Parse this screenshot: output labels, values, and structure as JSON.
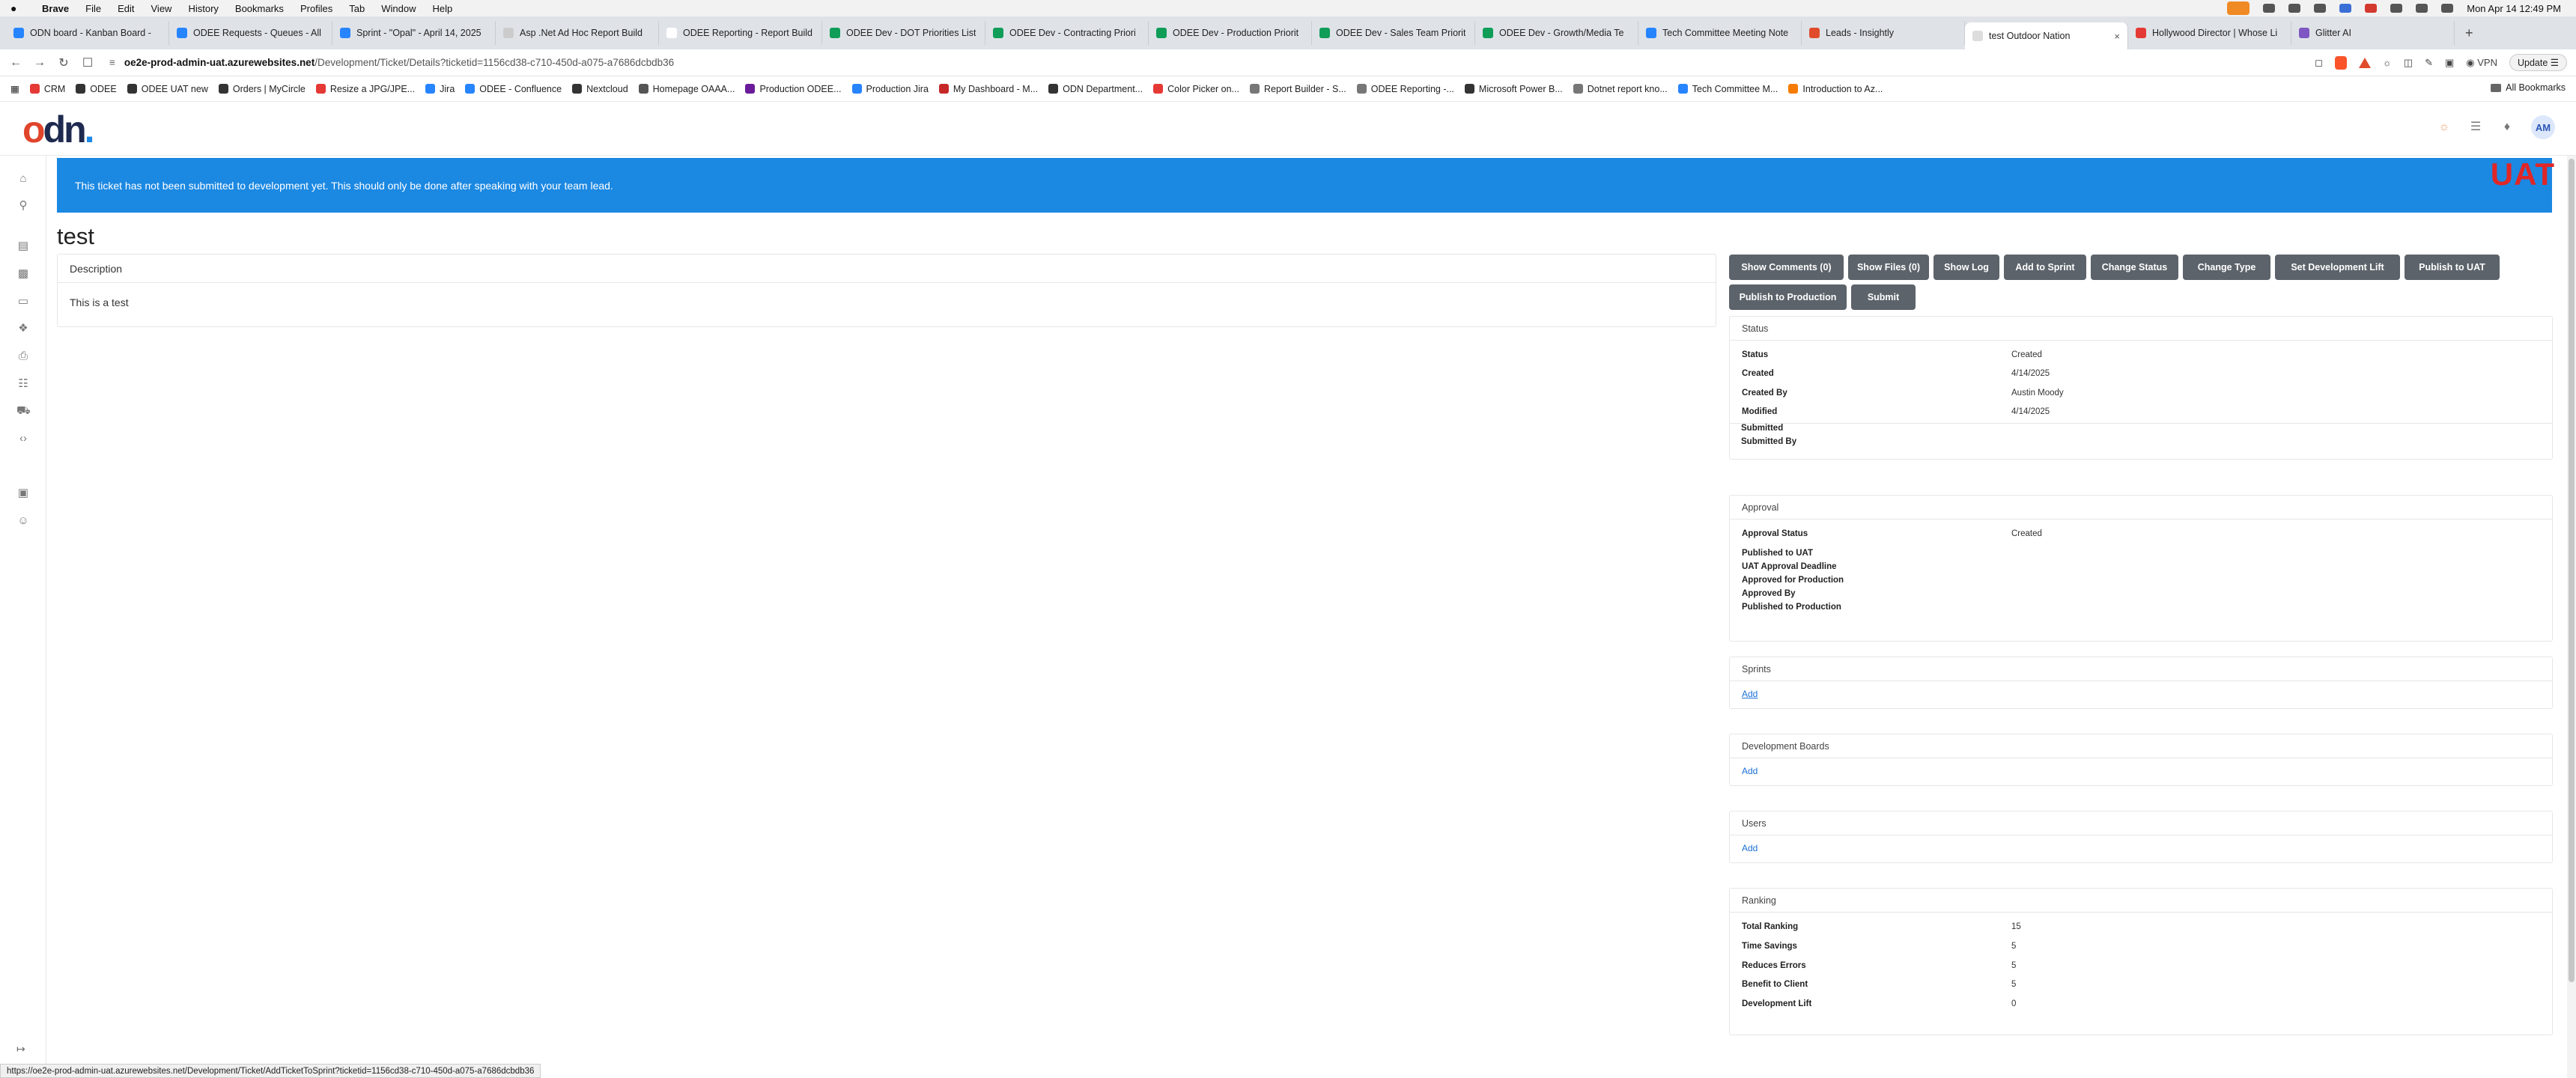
{
  "menubar": {
    "app": "Brave",
    "items": [
      "File",
      "Edit",
      "View",
      "History",
      "Bookmarks",
      "Profiles",
      "Tab",
      "Window",
      "Help"
    ],
    "datetime": "Mon Apr 14  12:49 PM"
  },
  "tabs": [
    {
      "label": "ODN board - Kanban Board -",
      "color": "#2684ff"
    },
    {
      "label": "ODEE Requests - Queues - All",
      "color": "#2684ff"
    },
    {
      "label": "Sprint - \"Opal\" - April 14, 2025",
      "color": "#2684ff"
    },
    {
      "label": "Asp .Net Ad Hoc Report Build",
      "color": "#cccccc"
    },
    {
      "label": "ODEE Reporting - Report Build",
      "color": "#ffffff"
    },
    {
      "label": "ODEE Dev - DOT Priorities List",
      "color": "#0f9d58"
    },
    {
      "label": "ODEE Dev - Contracting Priori",
      "color": "#0f9d58"
    },
    {
      "label": "ODEE Dev - Production Priorit",
      "color": "#0f9d58"
    },
    {
      "label": "ODEE Dev - Sales Team Priorit",
      "color": "#0f9d58"
    },
    {
      "label": "ODEE Dev - Growth/Media Te",
      "color": "#0f9d58"
    },
    {
      "label": "Tech Committee Meeting Note",
      "color": "#2684ff"
    },
    {
      "label": "Leads - Insightly",
      "color": "#e04b2c"
    },
    {
      "label": "test Outdoor Nation",
      "color": "#dddddd",
      "active": true
    },
    {
      "label": "Hollywood Director | Whose Li",
      "color": "#e53935"
    },
    {
      "label": "Glitter AI",
      "color": "#7e57c2"
    }
  ],
  "address": {
    "host": "oe2e-prod-admin-uat.azurewebsites.net",
    "path": "/Development/Ticket/Details?ticketid=1156cd38-c710-450d-a075-a7686dcbdb36",
    "vpn": "VPN",
    "update": "Update"
  },
  "bookmarks": [
    {
      "label": "CRM",
      "color": "#e53935"
    },
    {
      "label": "ODEE",
      "color": "#333333"
    },
    {
      "label": "ODEE UAT new",
      "color": "#333333"
    },
    {
      "label": "Orders | MyCircle",
      "color": "#333333"
    },
    {
      "label": "Resize a JPG/JPE...",
      "color": "#e53935"
    },
    {
      "label": "Jira",
      "color": "#2684ff"
    },
    {
      "label": "ODEE - Confluence",
      "color": "#2684ff"
    },
    {
      "label": "Nextcloud",
      "color": "#333333"
    },
    {
      "label": "Homepage OAAA...",
      "color": "#555555"
    },
    {
      "label": "Production ODEE...",
      "color": "#6a1b9a"
    },
    {
      "label": "Production Jira",
      "color": "#2684ff"
    },
    {
      "label": "My Dashboard - M...",
      "color": "#c62828"
    },
    {
      "label": "ODN Department...",
      "color": "#333333"
    },
    {
      "label": "Color Picker on...",
      "color": "#e53935"
    },
    {
      "label": "Report Builder - S...",
      "color": "#777777"
    },
    {
      "label": "ODEE Reporting -...",
      "color": "#777777"
    },
    {
      "label": "Microsoft Power B...",
      "color": "#333333"
    },
    {
      "label": "Dotnet report kno...",
      "color": "#777777"
    },
    {
      "label": "Tech Committee M...",
      "color": "#2684ff"
    },
    {
      "label": "Introduction to Az...",
      "color": "#f57c00"
    }
  ],
  "all_bookmarks": "All Bookmarks",
  "header": {
    "initials": "AM"
  },
  "alert": "This ticket has not been submitted to development yet. This should only be done after speaking with your team lead.",
  "env_badge": "UAT",
  "title": "test",
  "description": {
    "heading": "Description",
    "body": "This is a test"
  },
  "actions": [
    "Show Comments (0)",
    "Show Files (0)",
    "Show Log",
    "Add to Sprint",
    "Change Status",
    "Change Type",
    "Set Development Lift",
    "Publish to UAT",
    "Publish to Production",
    "Submit"
  ],
  "status_card": {
    "heading": "Status",
    "rows": [
      {
        "label": "Status",
        "value": "Created"
      },
      {
        "label": "Created",
        "value": "4/14/2025"
      },
      {
        "label": "Created By",
        "value": "Austin Moody"
      },
      {
        "label": "Modified",
        "value": "4/14/2025"
      },
      {
        "label": "Submitted",
        "value": ""
      },
      {
        "label": "Submitted By",
        "value": ""
      }
    ]
  },
  "approval_card": {
    "heading": "Approval",
    "rows": [
      {
        "label": "Approval Status",
        "value": "Created"
      },
      {
        "label": "Published to UAT",
        "value": ""
      },
      {
        "label": "UAT Approval Deadline",
        "value": ""
      },
      {
        "label": "Approved for Production",
        "value": ""
      },
      {
        "label": "Approved By",
        "value": ""
      },
      {
        "label": "Published to Production",
        "value": ""
      }
    ]
  },
  "sprints_card": {
    "heading": "Sprints",
    "link": "Add"
  },
  "boards_card": {
    "heading": "Development Boards",
    "link": "Add"
  },
  "users_card": {
    "heading": "Users",
    "link": "Add"
  },
  "ranking_card": {
    "heading": "Ranking",
    "rows": [
      {
        "label": "Total Ranking",
        "value": "15"
      },
      {
        "label": "Time Savings",
        "value": "5"
      },
      {
        "label": "Reduces Errors",
        "value": "5"
      },
      {
        "label": "Benefit to Client",
        "value": "5"
      },
      {
        "label": "Development Lift",
        "value": "0"
      }
    ]
  },
  "status_url": "https://oe2e-prod-admin-uat.azurewebsites.net/Development/Ticket/AddTicketToSprint?ticketid=1156cd38-c710-450d-a075-a7686dcbdb36"
}
